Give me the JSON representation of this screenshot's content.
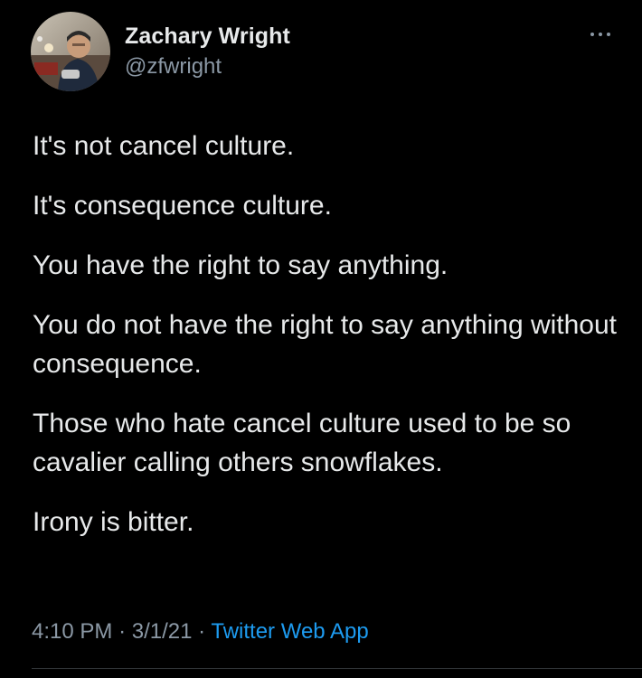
{
  "author": {
    "display_name": "Zachary Wright",
    "handle": "@zfwright"
  },
  "tweet": {
    "paragraphs": [
      "It's not cancel culture.",
      "It's consequence culture.",
      "You have the right to say anything.",
      "You do not have the right to say anything without consequence.",
      "Those who hate cancel culture used to be so cavalier calling others snowflakes.",
      "Irony is bitter."
    ],
    "time": "4:10 PM",
    "date": "3/1/21",
    "separator": "·",
    "source": "Twitter Web App"
  },
  "icons": {
    "more": "more-horizontal-icon",
    "avatar": "avatar"
  },
  "colors": {
    "background": "#000000",
    "primary_text": "#e7e9ea",
    "secondary_text": "#8b98a5",
    "link": "#1d9bf0"
  }
}
